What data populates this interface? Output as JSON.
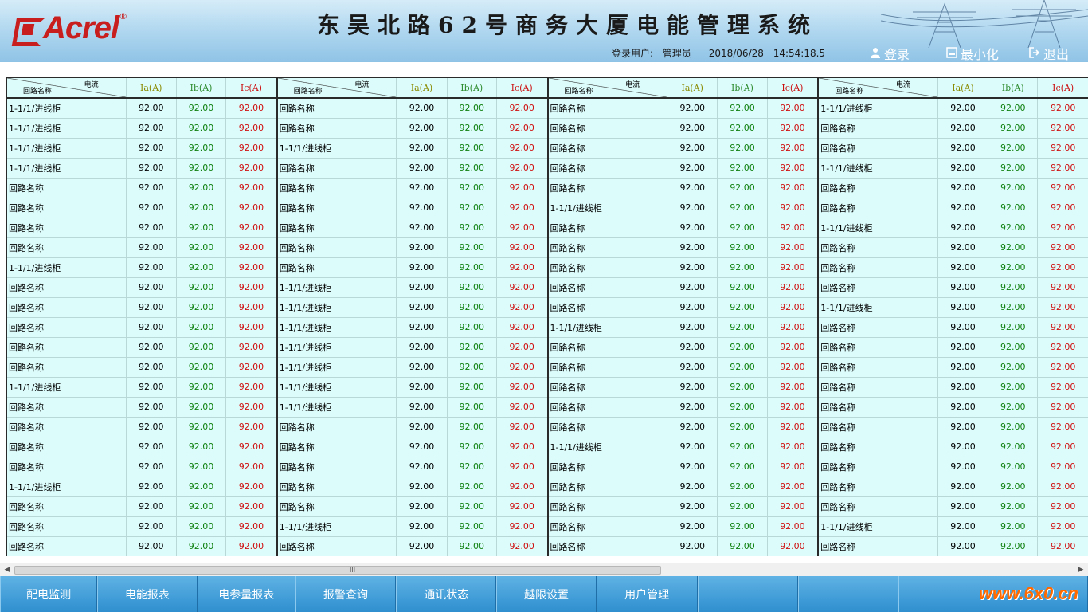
{
  "header": {
    "logo_text": "Acrel",
    "logo_reg": "®",
    "title": "东吴北路62号商务大厦电能管理系统",
    "user_label": "登录用户:",
    "user_name": "管理员",
    "date": "2018/06/28",
    "time": "14:54:18.5",
    "buttons": [
      {
        "label": "登录",
        "icon": "user-icon"
      },
      {
        "label": "最小化",
        "icon": "minimize-icon"
      },
      {
        "label": "退出",
        "icon": "exit-icon"
      }
    ]
  },
  "table_header": {
    "diag_top": "电流",
    "diag_bottom": "回路名称",
    "ia": "Ia(A)",
    "ib": "Ib(A)",
    "ic": "Ic(A)"
  },
  "tables": [
    {
      "rows": [
        {
          "name": "1-1/1/进线柜",
          "ia": "92.00",
          "ib": "92.00",
          "ic": "92.00"
        },
        {
          "name": "1-1/1/进线柜",
          "ia": "92.00",
          "ib": "92.00",
          "ic": "92.00"
        },
        {
          "name": "1-1/1/进线柜",
          "ia": "92.00",
          "ib": "92.00",
          "ic": "92.00"
        },
        {
          "name": "1-1/1/进线柜",
          "ia": "92.00",
          "ib": "92.00",
          "ic": "92.00"
        },
        {
          "name": "回路名称",
          "ia": "92.00",
          "ib": "92.00",
          "ic": "92.00"
        },
        {
          "name": "回路名称",
          "ia": "92.00",
          "ib": "92.00",
          "ic": "92.00"
        },
        {
          "name": "回路名称",
          "ia": "92.00",
          "ib": "92.00",
          "ic": "92.00"
        },
        {
          "name": "回路名称",
          "ia": "92.00",
          "ib": "92.00",
          "ic": "92.00"
        },
        {
          "name": "1-1/1/进线柜",
          "ia": "92.00",
          "ib": "92.00",
          "ic": "92.00"
        },
        {
          "name": "回路名称",
          "ia": "92.00",
          "ib": "92.00",
          "ic": "92.00"
        },
        {
          "name": "回路名称",
          "ia": "92.00",
          "ib": "92.00",
          "ic": "92.00"
        },
        {
          "name": "回路名称",
          "ia": "92.00",
          "ib": "92.00",
          "ic": "92.00"
        },
        {
          "name": "回路名称",
          "ia": "92.00",
          "ib": "92.00",
          "ic": "92.00"
        },
        {
          "name": "回路名称",
          "ia": "92.00",
          "ib": "92.00",
          "ic": "92.00"
        },
        {
          "name": "1-1/1/进线柜",
          "ia": "92.00",
          "ib": "92.00",
          "ic": "92.00"
        },
        {
          "name": "回路名称",
          "ia": "92.00",
          "ib": "92.00",
          "ic": "92.00"
        },
        {
          "name": "回路名称",
          "ia": "92.00",
          "ib": "92.00",
          "ic": "92.00"
        },
        {
          "name": "回路名称",
          "ia": "92.00",
          "ib": "92.00",
          "ic": "92.00"
        },
        {
          "name": "回路名称",
          "ia": "92.00",
          "ib": "92.00",
          "ic": "92.00"
        },
        {
          "name": "1-1/1/进线柜",
          "ia": "92.00",
          "ib": "92.00",
          "ic": "92.00"
        },
        {
          "name": "回路名称",
          "ia": "92.00",
          "ib": "92.00",
          "ic": "92.00"
        },
        {
          "name": "回路名称",
          "ia": "92.00",
          "ib": "92.00",
          "ic": "92.00"
        },
        {
          "name": "回路名称",
          "ia": "92.00",
          "ib": "92.00",
          "ic": "92.00"
        }
      ]
    },
    {
      "rows": [
        {
          "name": "回路名称",
          "ia": "92.00",
          "ib": "92.00",
          "ic": "92.00"
        },
        {
          "name": "回路名称",
          "ia": "92.00",
          "ib": "92.00",
          "ic": "92.00"
        },
        {
          "name": "1-1/1/进线柜",
          "ia": "92.00",
          "ib": "92.00",
          "ic": "92.00"
        },
        {
          "name": "回路名称",
          "ia": "92.00",
          "ib": "92.00",
          "ic": "92.00"
        },
        {
          "name": "回路名称",
          "ia": "92.00",
          "ib": "92.00",
          "ic": "92.00"
        },
        {
          "name": "回路名称",
          "ia": "92.00",
          "ib": "92.00",
          "ic": "92.00"
        },
        {
          "name": "回路名称",
          "ia": "92.00",
          "ib": "92.00",
          "ic": "92.00"
        },
        {
          "name": "回路名称",
          "ia": "92.00",
          "ib": "92.00",
          "ic": "92.00"
        },
        {
          "name": "回路名称",
          "ia": "92.00",
          "ib": "92.00",
          "ic": "92.00"
        },
        {
          "name": "1-1/1/进线柜",
          "ia": "92.00",
          "ib": "92.00",
          "ic": "92.00"
        },
        {
          "name": "1-1/1/进线柜",
          "ia": "92.00",
          "ib": "92.00",
          "ic": "92.00"
        },
        {
          "name": "1-1/1/进线柜",
          "ia": "92.00",
          "ib": "92.00",
          "ic": "92.00"
        },
        {
          "name": "1-1/1/进线柜",
          "ia": "92.00",
          "ib": "92.00",
          "ic": "92.00"
        },
        {
          "name": "1-1/1/进线柜",
          "ia": "92.00",
          "ib": "92.00",
          "ic": "92.00"
        },
        {
          "name": "1-1/1/进线柜",
          "ia": "92.00",
          "ib": "92.00",
          "ic": "92.00"
        },
        {
          "name": "1-1/1/进线柜",
          "ia": "92.00",
          "ib": "92.00",
          "ic": "92.00"
        },
        {
          "name": "回路名称",
          "ia": "92.00",
          "ib": "92.00",
          "ic": "92.00"
        },
        {
          "name": "回路名称",
          "ia": "92.00",
          "ib": "92.00",
          "ic": "92.00"
        },
        {
          "name": "回路名称",
          "ia": "92.00",
          "ib": "92.00",
          "ic": "92.00"
        },
        {
          "name": "回路名称",
          "ia": "92.00",
          "ib": "92.00",
          "ic": "92.00"
        },
        {
          "name": "回路名称",
          "ia": "92.00",
          "ib": "92.00",
          "ic": "92.00"
        },
        {
          "name": "1-1/1/进线柜",
          "ia": "92.00",
          "ib": "92.00",
          "ic": "92.00"
        },
        {
          "name": "回路名称",
          "ia": "92.00",
          "ib": "92.00",
          "ic": "92.00"
        }
      ]
    },
    {
      "rows": [
        {
          "name": "回路名称",
          "ia": "92.00",
          "ib": "92.00",
          "ic": "92.00"
        },
        {
          "name": "回路名称",
          "ia": "92.00",
          "ib": "92.00",
          "ic": "92.00"
        },
        {
          "name": "回路名称",
          "ia": "92.00",
          "ib": "92.00",
          "ic": "92.00"
        },
        {
          "name": "回路名称",
          "ia": "92.00",
          "ib": "92.00",
          "ic": "92.00"
        },
        {
          "name": "回路名称",
          "ia": "92.00",
          "ib": "92.00",
          "ic": "92.00"
        },
        {
          "name": "1-1/1/进线柜",
          "ia": "92.00",
          "ib": "92.00",
          "ic": "92.00"
        },
        {
          "name": "回路名称",
          "ia": "92.00",
          "ib": "92.00",
          "ic": "92.00"
        },
        {
          "name": "回路名称",
          "ia": "92.00",
          "ib": "92.00",
          "ic": "92.00"
        },
        {
          "name": "回路名称",
          "ia": "92.00",
          "ib": "92.00",
          "ic": "92.00"
        },
        {
          "name": "回路名称",
          "ia": "92.00",
          "ib": "92.00",
          "ic": "92.00"
        },
        {
          "name": "回路名称",
          "ia": "92.00",
          "ib": "92.00",
          "ic": "92.00"
        },
        {
          "name": "1-1/1/进线柜",
          "ia": "92.00",
          "ib": "92.00",
          "ic": "92.00"
        },
        {
          "name": "回路名称",
          "ia": "92.00",
          "ib": "92.00",
          "ic": "92.00"
        },
        {
          "name": "回路名称",
          "ia": "92.00",
          "ib": "92.00",
          "ic": "92.00"
        },
        {
          "name": "回路名称",
          "ia": "92.00",
          "ib": "92.00",
          "ic": "92.00"
        },
        {
          "name": "回路名称",
          "ia": "92.00",
          "ib": "92.00",
          "ic": "92.00"
        },
        {
          "name": "回路名称",
          "ia": "92.00",
          "ib": "92.00",
          "ic": "92.00"
        },
        {
          "name": "1-1/1/进线柜",
          "ia": "92.00",
          "ib": "92.00",
          "ic": "92.00"
        },
        {
          "name": "回路名称",
          "ia": "92.00",
          "ib": "92.00",
          "ic": "92.00"
        },
        {
          "name": "回路名称",
          "ia": "92.00",
          "ib": "92.00",
          "ic": "92.00"
        },
        {
          "name": "回路名称",
          "ia": "92.00",
          "ib": "92.00",
          "ic": "92.00"
        },
        {
          "name": "回路名称",
          "ia": "92.00",
          "ib": "92.00",
          "ic": "92.00"
        },
        {
          "name": "回路名称",
          "ia": "92.00",
          "ib": "92.00",
          "ic": "92.00"
        }
      ]
    },
    {
      "rows": [
        {
          "name": "1-1/1/进线柜",
          "ia": "92.00",
          "ib": "92.00",
          "ic": "92.00"
        },
        {
          "name": "回路名称",
          "ia": "92.00",
          "ib": "92.00",
          "ic": "92.00"
        },
        {
          "name": "回路名称",
          "ia": "92.00",
          "ib": "92.00",
          "ic": "92.00"
        },
        {
          "name": "1-1/1/进线柜",
          "ia": "92.00",
          "ib": "92.00",
          "ic": "92.00"
        },
        {
          "name": "回路名称",
          "ia": "92.00",
          "ib": "92.00",
          "ic": "92.00"
        },
        {
          "name": "回路名称",
          "ia": "92.00",
          "ib": "92.00",
          "ic": "92.00"
        },
        {
          "name": "1-1/1/进线柜",
          "ia": "92.00",
          "ib": "92.00",
          "ic": "92.00"
        },
        {
          "name": "回路名称",
          "ia": "92.00",
          "ib": "92.00",
          "ic": "92.00"
        },
        {
          "name": "回路名称",
          "ia": "92.00",
          "ib": "92.00",
          "ic": "92.00"
        },
        {
          "name": "回路名称",
          "ia": "92.00",
          "ib": "92.00",
          "ic": "92.00"
        },
        {
          "name": "1-1/1/进线柜",
          "ia": "92.00",
          "ib": "92.00",
          "ic": "92.00"
        },
        {
          "name": "回路名称",
          "ia": "92.00",
          "ib": "92.00",
          "ic": "92.00"
        },
        {
          "name": "回路名称",
          "ia": "92.00",
          "ib": "92.00",
          "ic": "92.00"
        },
        {
          "name": "回路名称",
          "ia": "92.00",
          "ib": "92.00",
          "ic": "92.00"
        },
        {
          "name": "回路名称",
          "ia": "92.00",
          "ib": "92.00",
          "ic": "92.00"
        },
        {
          "name": "回路名称",
          "ia": "92.00",
          "ib": "92.00",
          "ic": "92.00"
        },
        {
          "name": "回路名称",
          "ia": "92.00",
          "ib": "92.00",
          "ic": "92.00"
        },
        {
          "name": "回路名称",
          "ia": "92.00",
          "ib": "92.00",
          "ic": "92.00"
        },
        {
          "name": "回路名称",
          "ia": "92.00",
          "ib": "92.00",
          "ic": "92.00"
        },
        {
          "name": "回路名称",
          "ia": "92.00",
          "ib": "92.00",
          "ic": "92.00"
        },
        {
          "name": "回路名称",
          "ia": "92.00",
          "ib": "92.00",
          "ic": "92.00"
        },
        {
          "name": "1-1/1/进线柜",
          "ia": "92.00",
          "ib": "92.00",
          "ic": "92.00"
        },
        {
          "name": "回路名称",
          "ia": "92.00",
          "ib": "92.00",
          "ic": "92.00"
        }
      ]
    }
  ],
  "scrollbar": {
    "grip": "III"
  },
  "nav": [
    {
      "label": "配电监测"
    },
    {
      "label": "电能报表"
    },
    {
      "label": "电参量报表"
    },
    {
      "label": "报警查询"
    },
    {
      "label": "通讯状态"
    },
    {
      "label": "越限设置"
    },
    {
      "label": "用户管理"
    },
    {
      "label": ""
    },
    {
      "label": ""
    },
    {
      "label": ""
    }
  ],
  "watermark": "www.6x0.cn",
  "colors": {
    "table_bg": "#dcfcfb",
    "ia": "#8a8a00",
    "ib": "#2e8b2e",
    "ic": "#cc1010",
    "nav": "#2f8fcf"
  }
}
